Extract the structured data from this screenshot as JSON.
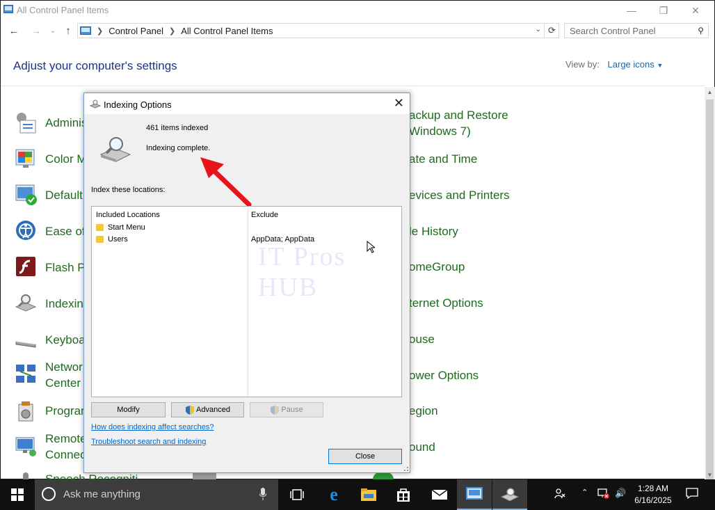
{
  "window": {
    "title": "All Control Panel Items",
    "controls": {
      "minimize": "—",
      "maximize": "❐",
      "close": "✕"
    }
  },
  "address_bar": {
    "breadcrumb": [
      "Control Panel",
      "All Control Panel Items"
    ],
    "search_placeholder": "Search Control Panel"
  },
  "header": {
    "title": "Adjust your computer's settings",
    "view_by_label": "View by:",
    "view_by_value": "Large icons"
  },
  "items_left": [
    {
      "label": "Adminis",
      "icon": "administrative-tools-icon"
    },
    {
      "label": "Color M",
      "icon": "color-management-icon"
    },
    {
      "label": "Default",
      "icon": "default-programs-icon"
    },
    {
      "label": "Ease of A",
      "icon": "ease-of-access-icon"
    },
    {
      "label": "Flash Pla",
      "icon": "flash-player-icon"
    },
    {
      "label": "Indexing",
      "icon": "indexing-options-icon"
    },
    {
      "label": "Keyboa",
      "icon": "keyboard-icon"
    },
    {
      "label": "Network",
      "label2": "Center",
      "icon": "network-center-icon"
    },
    {
      "label": "Program",
      "icon": "programs-icon"
    },
    {
      "label": "Remote",
      "label2": "Connect",
      "icon": "remote-connections-icon"
    },
    {
      "label": "Speech Recogniti",
      "icon": "speech-recognition-icon"
    }
  ],
  "items_right": [
    {
      "label": "ackup and Restore",
      "label2": "Windows 7)"
    },
    {
      "label": "ate and Time"
    },
    {
      "label": "evices and Printers"
    },
    {
      "label": "le History"
    },
    {
      "label": "omeGroup"
    },
    {
      "label": "ternet Options"
    },
    {
      "label": "ouse"
    },
    {
      "label": "ower Options"
    },
    {
      "label": "egion"
    },
    {
      "label": "ound"
    }
  ],
  "dialog": {
    "title": "Indexing Options",
    "items_indexed": "461 items indexed",
    "status": "Indexing complete.",
    "index_locations_label": "Index these locations:",
    "col_included": "Included Locations",
    "col_exclude": "Exclude",
    "locations": [
      {
        "name": "Start Menu",
        "exclude": ""
      },
      {
        "name": "Users",
        "exclude": "AppData; AppData"
      }
    ],
    "buttons": {
      "modify": "Modify",
      "advanced": "Advanced",
      "pause": "Pause",
      "close": "Close"
    },
    "links": {
      "affect": "How does indexing affect searches?",
      "troubleshoot": "Troubleshoot search and indexing"
    },
    "watermark": "IT Pros HUB"
  },
  "taskbar": {
    "search_text": "Ask me anything",
    "time": "1:28 AM",
    "date": "6/16/2025"
  },
  "colors": {
    "accent_link": "#0066cc",
    "item_green": "#1e6b1e",
    "heading_blue": "#1e3287",
    "arrow_red": "#e8141b",
    "taskbar_bg": "#101010"
  }
}
